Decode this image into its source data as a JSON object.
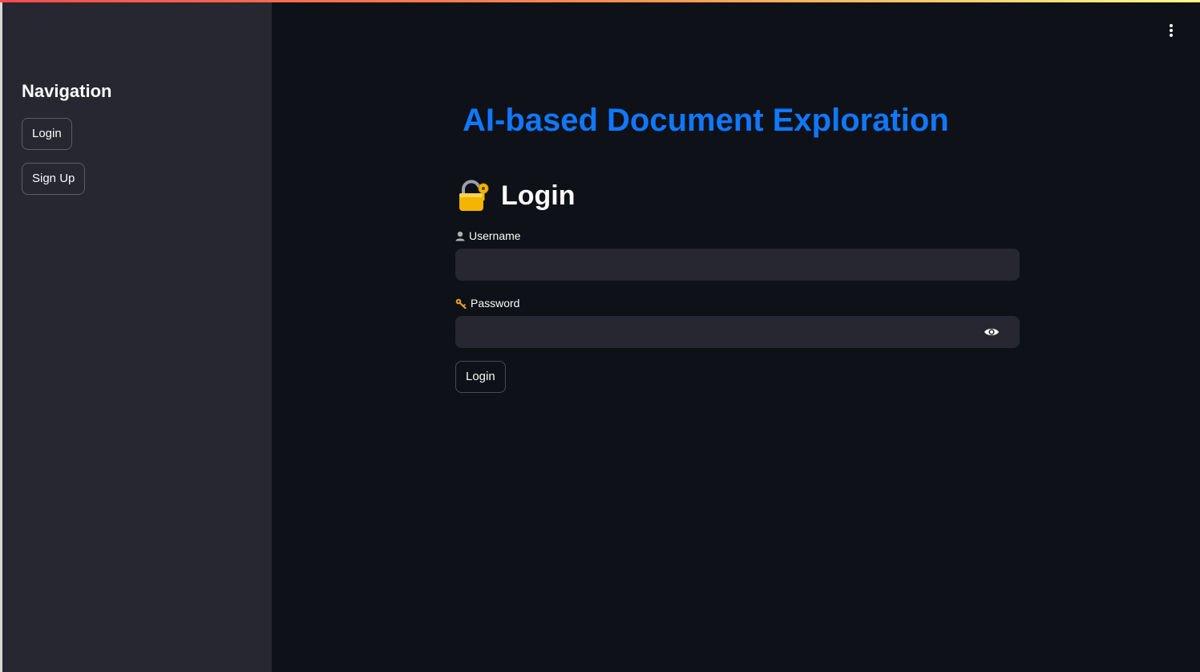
{
  "sidebar": {
    "title": "Navigation",
    "buttons": [
      {
        "label": "Login"
      },
      {
        "label": "Sign Up"
      }
    ]
  },
  "main": {
    "app_title": "AI-based Document Exploration",
    "form": {
      "heading": "Login",
      "heading_icon": "lock-with-key-icon",
      "username": {
        "label": "Username",
        "icon": "user-silhouette-icon",
        "value": "",
        "placeholder": ""
      },
      "password": {
        "label": "Password",
        "icon": "key-icon",
        "value": "",
        "placeholder": "",
        "toggle_icon": "eye-icon"
      },
      "submit_label": "Login"
    },
    "menu_icon": "kebab-menu-icon"
  },
  "colors": {
    "background": "#0e1117",
    "sidebar": "#262730",
    "title_accent": "#1177ff",
    "input_bg": "#262730",
    "top_bar_gradient": [
      "#ff4b4b",
      "#fffd80"
    ]
  }
}
